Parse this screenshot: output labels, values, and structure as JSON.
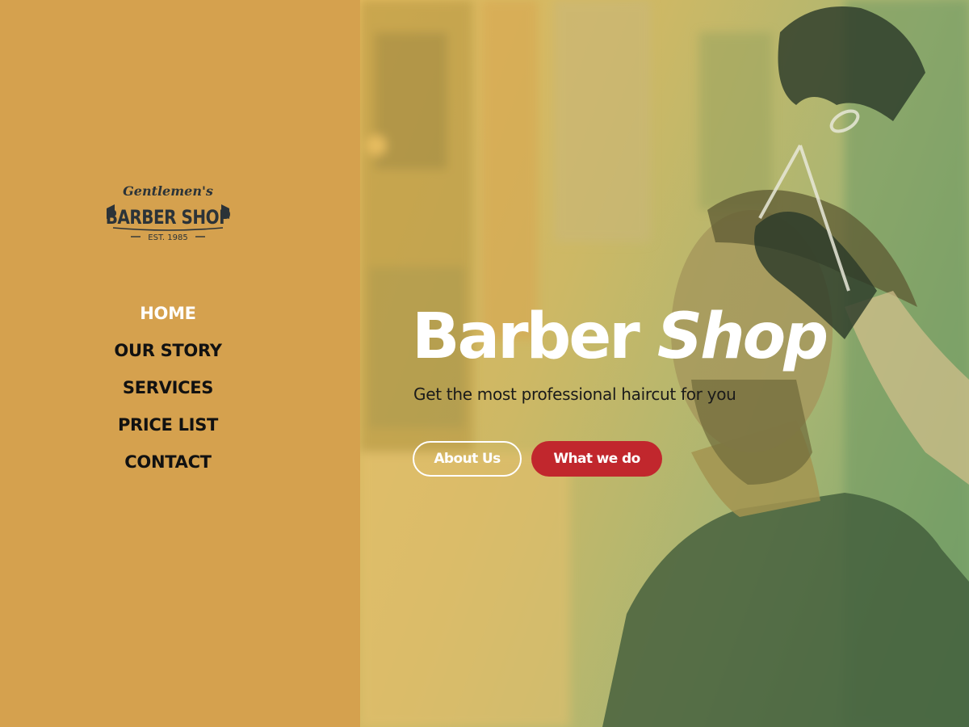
{
  "logo": {
    "script_text": "Gentlemen's",
    "main_text": "BARBER SHOP",
    "est_text": "EST. 1985"
  },
  "nav": {
    "items": [
      {
        "label": "HOME",
        "active": true
      },
      {
        "label": "OUR STORY",
        "active": false
      },
      {
        "label": "SERVICES",
        "active": false
      },
      {
        "label": "PRICE LIST",
        "active": false
      },
      {
        "label": "CONTACT",
        "active": false
      }
    ]
  },
  "hero": {
    "title_plain": "Barber",
    "title_italic": "Shop",
    "subtitle": "Get the most professional haircut for you",
    "buttons": {
      "about_label": "About Us",
      "what_label": "What we do"
    }
  },
  "colors": {
    "sidebar_bg": "#d5a14e",
    "logo_ink": "#2b3338",
    "nav_active": "#ffffff",
    "nav_text": "#111111",
    "cta_red": "#c1272d",
    "hero_overlay_start": "#e4bb5f",
    "hero_overlay_end": "#73a26a"
  }
}
